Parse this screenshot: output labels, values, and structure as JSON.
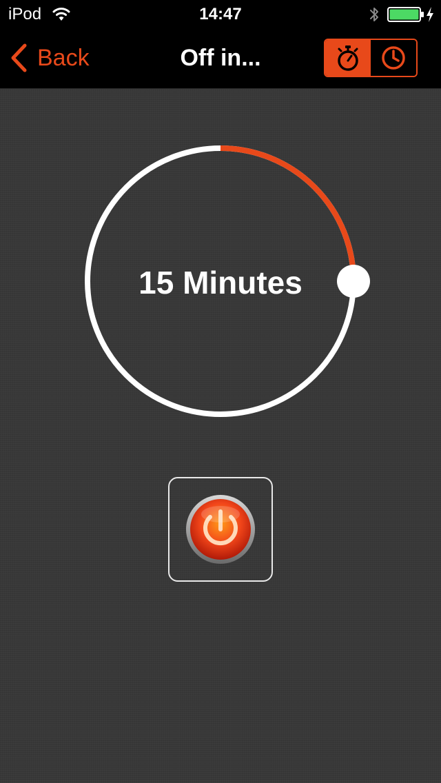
{
  "status_bar": {
    "carrier": "iPod",
    "time": "14:47",
    "wifi_icon": "wifi-icon",
    "bluetooth_icon": "bluetooth-icon",
    "battery_icon": "battery-icon",
    "charging_icon": "charging-bolt-icon",
    "battery_color": "#4cd964",
    "battery_level": 1.0
  },
  "nav": {
    "back_label": "Back",
    "title": "Off in...",
    "segments": [
      {
        "icon": "stopwatch-icon",
        "selected": true
      },
      {
        "icon": "clock-icon",
        "selected": false
      }
    ]
  },
  "timer": {
    "label": "15 Minutes",
    "progress_fraction": 0.25
  },
  "power_button": {
    "icon": "power-icon"
  },
  "colors": {
    "accent": "#e8491a",
    "ring": "#ffffff",
    "background": "#383838",
    "bar_background": "#000000"
  }
}
